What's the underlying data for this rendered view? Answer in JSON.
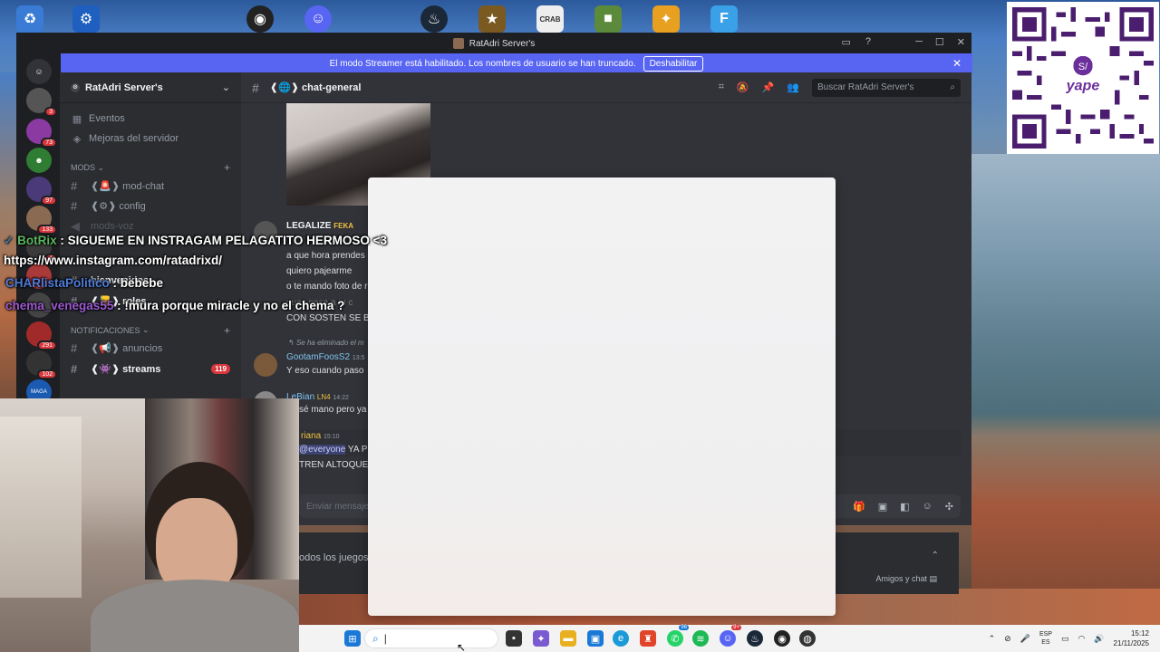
{
  "window": {
    "title": "RatAdri Server's"
  },
  "streamer_bar": {
    "message": "El modo Streamer está habilitado. Los nombres de usuario se han truncado.",
    "button": "Deshabilitar",
    "close": "✕"
  },
  "server_rail": {
    "badges": [
      "3",
      "73",
      "97",
      "133",
      "4",
      "291",
      "102",
      "165"
    ],
    "maga_label": "MAGA"
  },
  "sidebar": {
    "server_name": "RatAdri Server's",
    "items": [
      {
        "label": "Eventos"
      },
      {
        "label": "Mejoras del servidor"
      }
    ],
    "categories": [
      {
        "label": "MODS",
        "channels": [
          {
            "label": "❰🚨❱ mod-chat"
          },
          {
            "label": "❰⚙❱ config"
          },
          {
            "label": "mods-voz"
          }
        ]
      },
      {
        "label": "NOTIFICACIONES",
        "channels": [
          {
            "label": "❰📢❱ anuncios"
          },
          {
            "label": "❰👾❱ streams",
            "count": "119"
          }
        ]
      }
    ],
    "hidden_channels": [
      {
        "label": "bienvenidos"
      },
      {
        "label": "❰📒❱ roles"
      }
    ]
  },
  "chat_header": {
    "channel": "❰🌐❱ chat-general",
    "search_placeholder": "Buscar RatAdri Server's"
  },
  "messages": {
    "legalize_name": "LEGALIZE",
    "legalize_tag": "FEKA",
    "lines": [
      "a que hora prendes",
      "quiero pajearme",
      "o te mando foto de r",
      "pues pasa a tu c",
      "CON SOSTEN SE BA"
    ],
    "deleted_note": "Se ha eliminado el m",
    "gootam_name": "GootamFoosS2",
    "gootam_time": "13:5",
    "gootam_text": "Y eso cuando paso",
    "lebian_name": "LeBian",
    "lebian_tag": "LN4",
    "lebian_time": "14:22",
    "lebian_text": "sé mano pero ya",
    "riana_name": "riana",
    "riana_time": "15:10",
    "riana_mention": "@everyone",
    "riana_text": "YA PRE",
    "riana_text2": "TREN ALTOQUE"
  },
  "composer": {
    "placeholder": "Enviar mensaje a #"
  },
  "lower_panel": {
    "games": "odos los juegos",
    "friends": "Amigos y chat"
  },
  "chat_overlay": [
    {
      "user": "BotRix",
      "text": " : SIGUEME EN INSTRAGAM PELAGATITO HERMOSO <3"
    },
    {
      "user": "",
      "text": "https://www.instagram.com/ratadrixd/"
    },
    {
      "user": "CHARlistaPolitico",
      "text": " : bebebe"
    },
    {
      "user": "chema_venegas55",
      "text": " : !mura porque miracle y no el chema ?"
    }
  ],
  "taskbar": {
    "search_value": "|",
    "lang_top": "ESP",
    "lang_bottom": "ES",
    "time": "15:12",
    "date": "21/11/2025",
    "whatsapp_badge": "96",
    "discord_badge": "9+"
  },
  "qr": {
    "brand": "yape",
    "symbol": "S/"
  },
  "colors": {
    "discord_blurple": "#5865f2",
    "discord_bg": "#313338",
    "badge_red": "#da373c"
  }
}
